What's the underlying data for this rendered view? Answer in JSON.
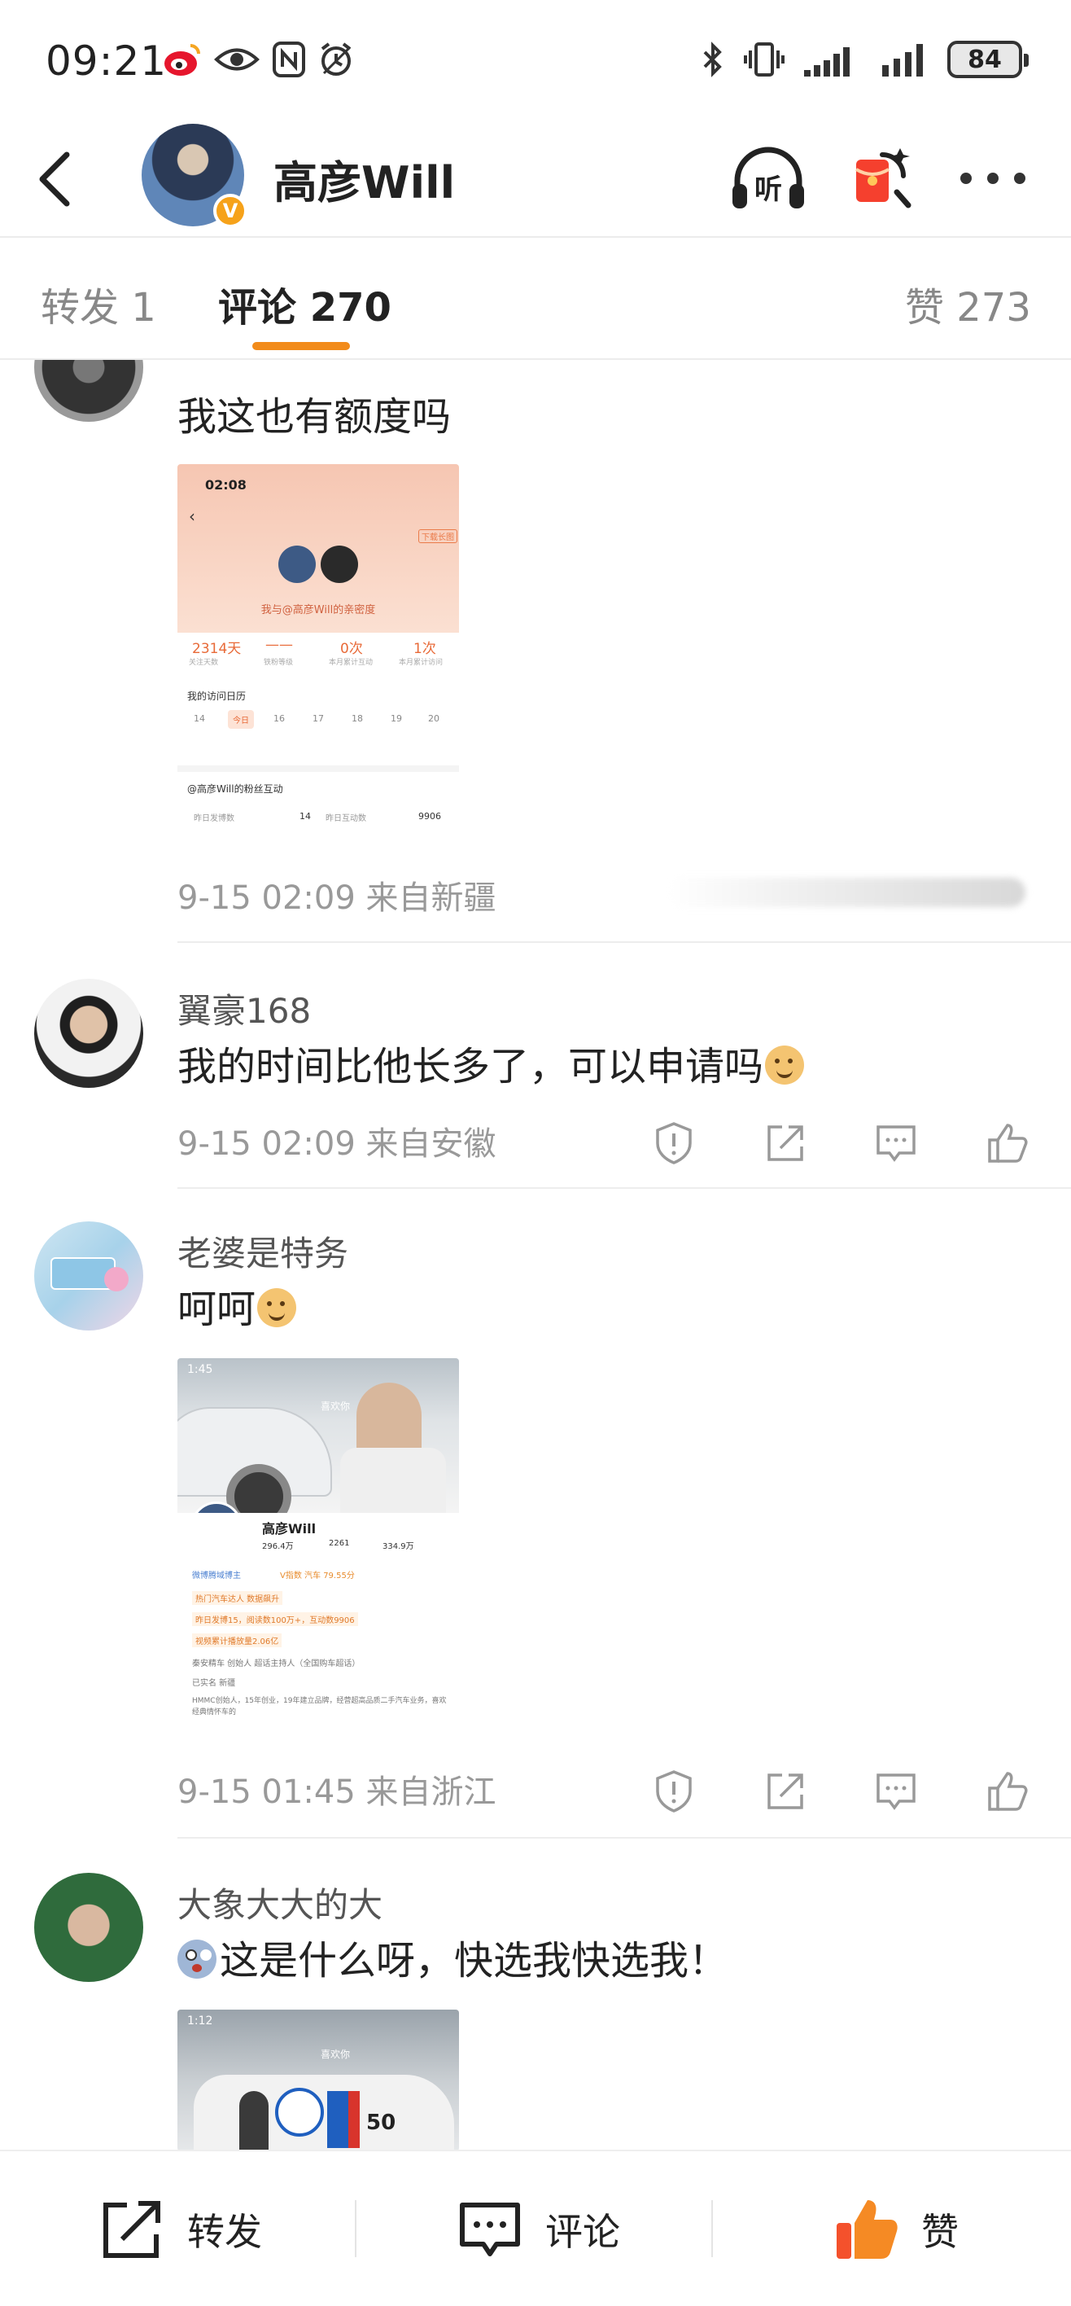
{
  "status_bar": {
    "time": "09:21",
    "battery": "84",
    "icons": [
      "weibo-icon",
      "eye-icon",
      "nfc-icon",
      "alarm-icon",
      "bluetooth-icon",
      "vibrate-icon",
      "signal-icon",
      "signal-icon",
      "battery-icon"
    ]
  },
  "header": {
    "title": "高彦Will",
    "listen_label": "听",
    "verified_badge": "V"
  },
  "tabs": {
    "repost": "转发 1",
    "comments": "评论 270",
    "likes": "赞 273"
  },
  "comments": [
    {
      "name": "",
      "text": "我这也有额度吗",
      "meta": "9-15 02:09 来自新疆",
      "image": {
        "status_time": "02:08",
        "caption": "我与@高彦Will的亲密度",
        "stats": [
          "2314天",
          "——",
          "0次",
          "1次"
        ],
        "stat_labels": [
          "关注天数",
          "铁粉等级",
          "本月累计互动",
          "本月累计访问"
        ],
        "calendar_title": "我的访问日历",
        "days": [
          "14",
          "今日",
          "16",
          "17",
          "18",
          "19",
          "20"
        ],
        "section": "@高彦Will的粉丝互动",
        "row_label_a": "昨日发博数",
        "row_value_a": "14",
        "row_label_b": "昨日互动数",
        "row_value_b": "9906",
        "download_tag": "下载长图"
      }
    },
    {
      "name": "翼豪168",
      "text": "我的时间比他长多了，可以申请吗",
      "meta": "9-15 02:09 来自安徽"
    },
    {
      "name": "老婆是特务",
      "text": "呵呵",
      "meta": "9-15 01:45 来自浙江",
      "image": {
        "status_time": "1:45",
        "profile_name": "高彦Will",
        "followers": "296.4万",
        "following": "2261",
        "likes": "334.9万",
        "tag_a": "微博腾域博主",
        "tag_b": "V指数 汽车 79.55分",
        "line1": "热门汽车达人 数据飙升",
        "line2": "昨日发博15，阅读数100万+，互动数9906",
        "line3": "视频累计播放量2.06亿",
        "line4": "秦安精车 创始人 超话主持人（全国购车超话）",
        "line5": "已实名   新疆",
        "line6": "HMMC创始人，15年创业，19年建立品牌，经营超高品质二手汽车业务，喜欢经典情怀车的",
        "like_tag": "喜欢你"
      }
    },
    {
      "name": "大象大大的大",
      "text": "这是什么呀，快选我快选我！",
      "image": {
        "status_time": "1:12",
        "like_tag": "喜欢你",
        "car_number": "50"
      }
    }
  ],
  "bottom_bar": {
    "repost": "转发",
    "comment": "评论",
    "like": "赞"
  }
}
